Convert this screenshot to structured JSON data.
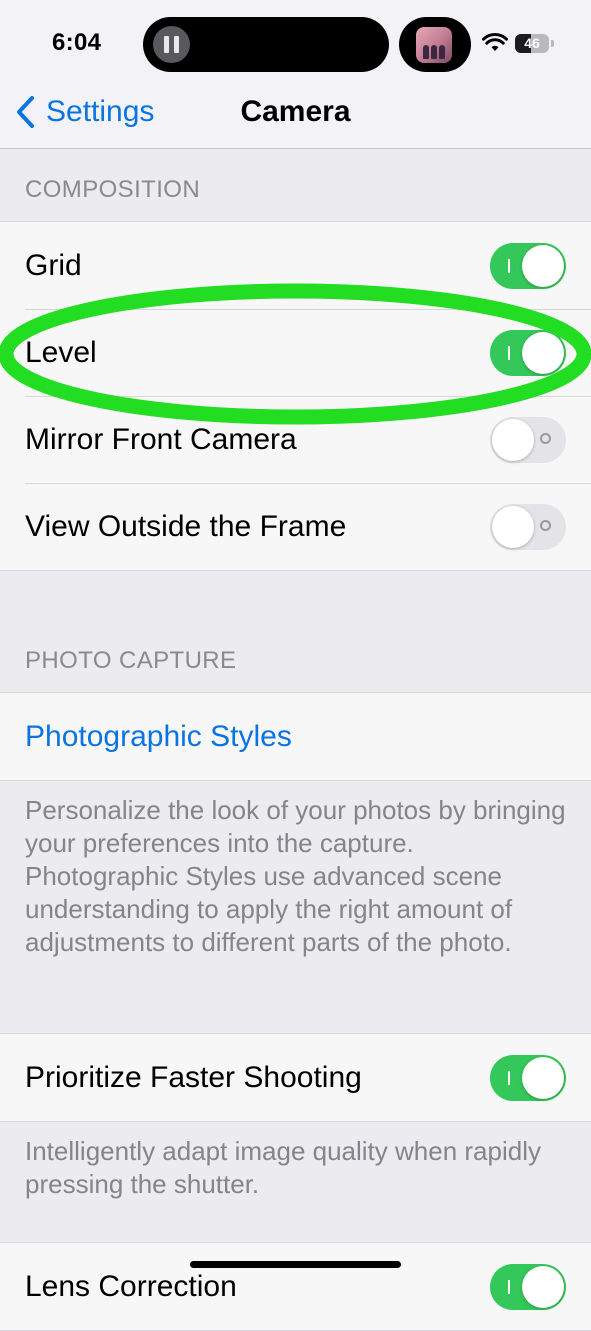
{
  "status_bar": {
    "time": "6:04",
    "battery_level": "46",
    "battery_fraction": 0.46,
    "icons": [
      "pause-icon",
      "app-thumbnail-icon",
      "wifi-icon",
      "battery-icon"
    ]
  },
  "nav": {
    "back_label": "Settings",
    "title": "Camera"
  },
  "composition": {
    "header": "COMPOSITION",
    "rows": [
      {
        "label": "Grid",
        "state": "on"
      },
      {
        "label": "Level",
        "state": "on"
      },
      {
        "label": "Mirror Front Camera",
        "state": "off"
      },
      {
        "label": "View Outside the Frame",
        "state": "off"
      }
    ]
  },
  "photo_capture": {
    "header": "PHOTO CAPTURE",
    "styles_link": "Photographic Styles",
    "styles_footer": "Personalize the look of your photos by bringing your preferences into the capture. Photographic Styles use advanced scene understanding to apply the right amount of adjustments to different parts of the photo.",
    "faster_shooting_label": "Prioritize Faster Shooting",
    "faster_shooting_state": "on",
    "faster_shooting_footer": "Intelligently adapt image quality when rapidly pressing the shutter.",
    "partial_row_label": "Lens Correction",
    "partial_row_state": "on"
  },
  "colors": {
    "accent_blue": "#0a74e0",
    "toggle_on": "#34c759",
    "toggle_off": "#e4e4e8",
    "annotation": "#22dd22"
  }
}
